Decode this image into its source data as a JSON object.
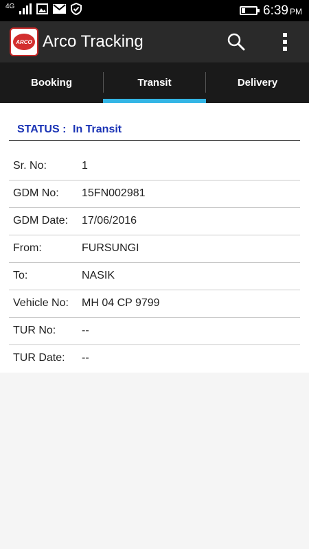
{
  "status_bar": {
    "network": "4G",
    "time": "6:39",
    "ampm": "PM"
  },
  "app_bar": {
    "logo_text": "ARCO",
    "title": "Arco Tracking"
  },
  "tabs": [
    {
      "label": "Booking",
      "active": false
    },
    {
      "label": "Transit",
      "active": true
    },
    {
      "label": "Delivery",
      "active": false
    }
  ],
  "status": {
    "label": "STATUS :",
    "value": "In Transit"
  },
  "details": [
    {
      "key": "Sr. No:",
      "value": "1"
    },
    {
      "key": "GDM No:",
      "value": "15FN002981"
    },
    {
      "key": "GDM Date:",
      "value": "17/06/2016"
    },
    {
      "key": "From:",
      "value": "FURSUNGI"
    },
    {
      "key": "To:",
      "value": "NASIK"
    },
    {
      "key": "Vehicle No:",
      "value": "MH 04 CP 9799"
    },
    {
      "key": "TUR No:",
      "value": "--"
    },
    {
      "key": "TUR Date:",
      "value": "--"
    }
  ],
  "colors": {
    "tab_indicator": "#33b5e5",
    "status_text": "#1a33b5",
    "app_bar": "#2a2a2a",
    "tab_bar": "#1a1a1a"
  }
}
